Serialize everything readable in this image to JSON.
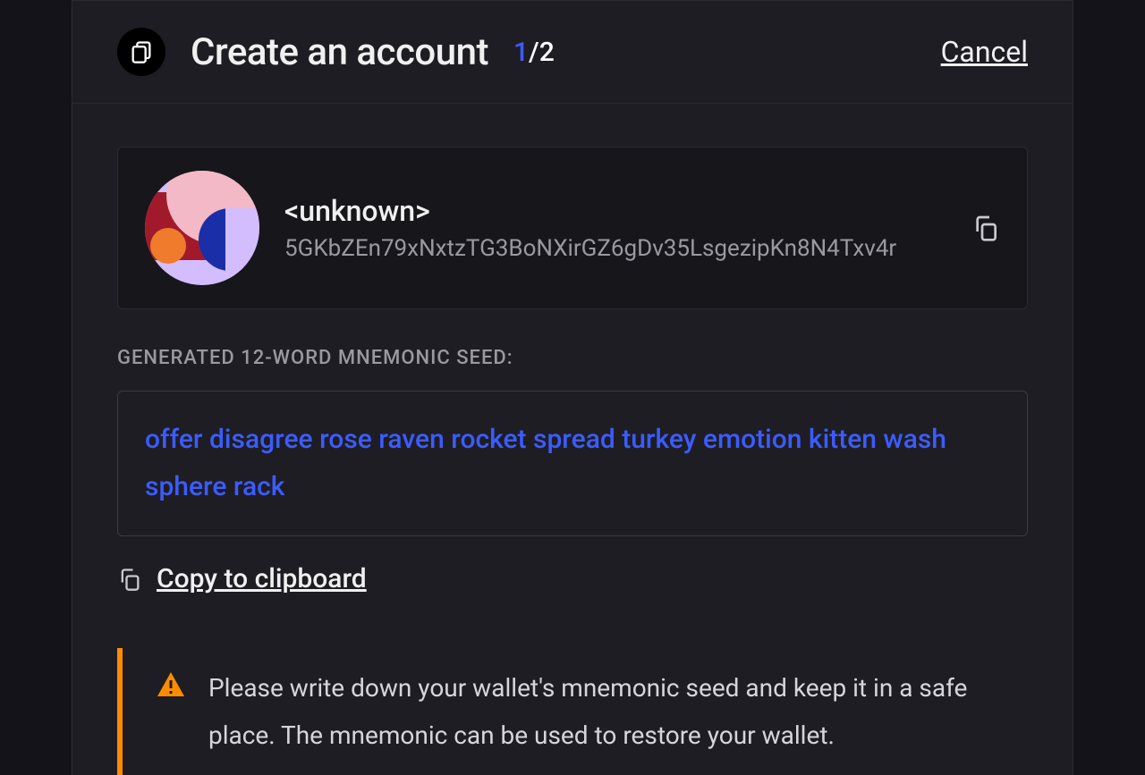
{
  "header": {
    "title": "Create an account",
    "step_current": "1",
    "step_sep": "/",
    "step_total": "2",
    "cancel": "Cancel"
  },
  "account": {
    "name": "<unknown>",
    "address": "5GKbZEn79xNxtzTG3BoNXirGZ6gDv35LsgezipKn8N4Txv4r"
  },
  "seed": {
    "label": "GENERATED 12-WORD MNEMONIC SEED:",
    "phrase": "offer disagree rose raven rocket spread turkey emotion kitten wash sphere rack",
    "copy_label": "Copy to clipboard"
  },
  "warning": {
    "text": "Please write down your wallet's mnemonic seed and keep it in a safe place. The mnemonic can be used to restore your wallet."
  }
}
